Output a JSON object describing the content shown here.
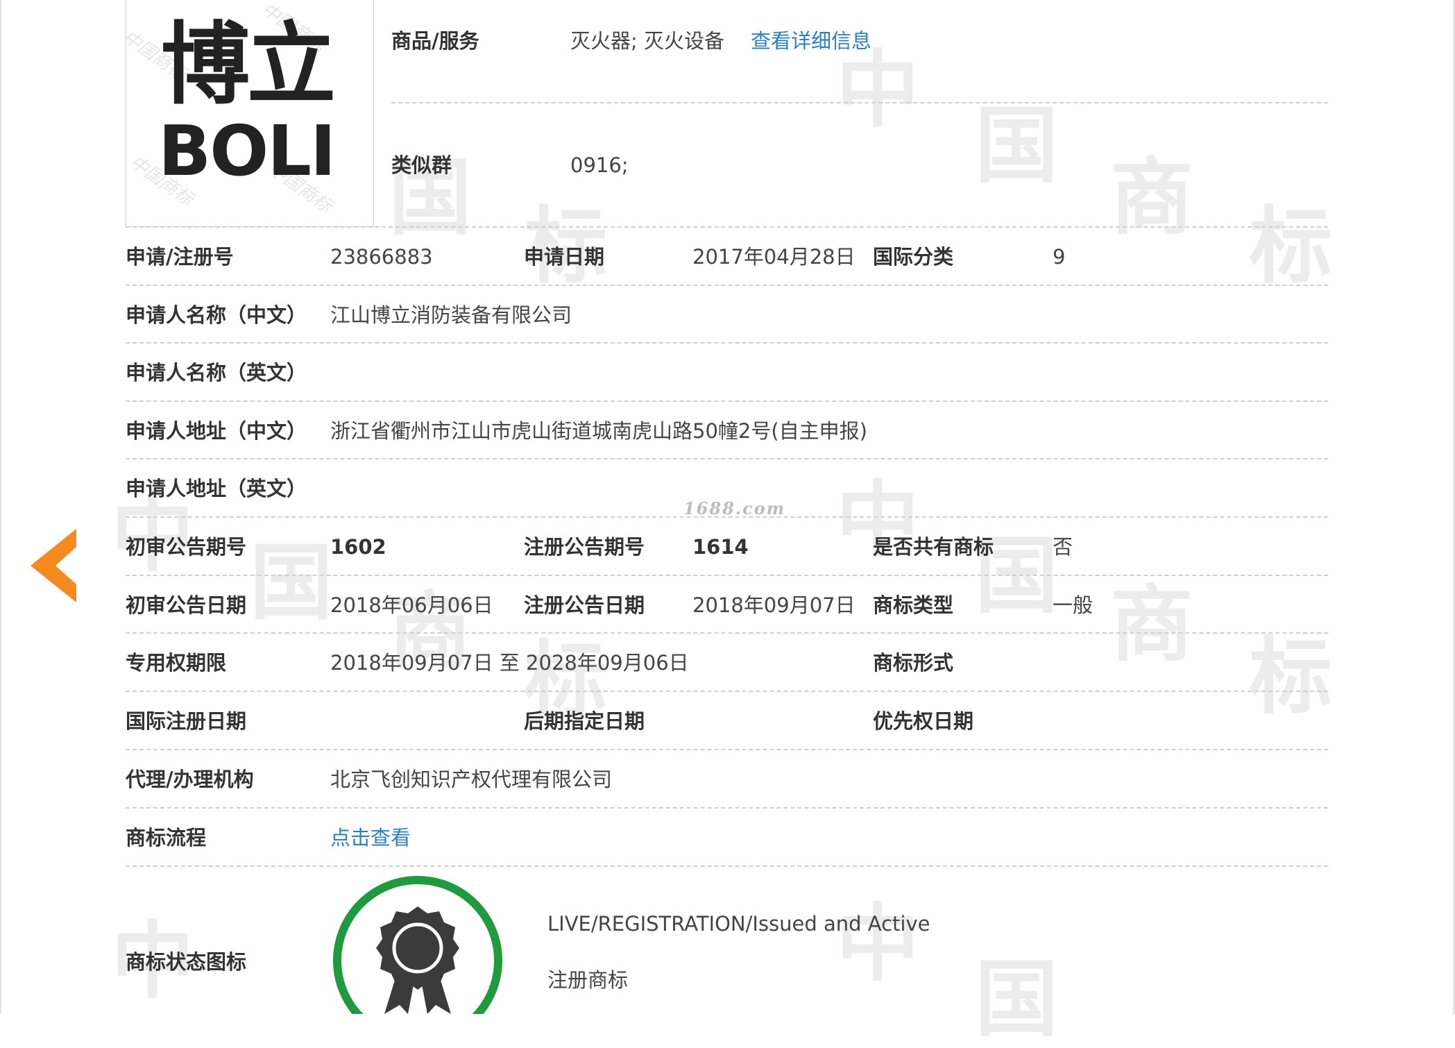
{
  "colors": {
    "accent_link": "#2a7fc2",
    "arrow": "#f58a1f",
    "badge_ring": "#1f9a3c",
    "badge_medal": "#3b3b3b"
  },
  "icons": {
    "back": "chevron-left-icon",
    "status": "award-ribbon-icon"
  },
  "watermark": {
    "site": "1688.com",
    "chars": [
      "中",
      "国",
      "商",
      "标"
    ],
    "logo_stamp": "中国商标"
  },
  "logo": {
    "cn": "博立",
    "en": "BOLI"
  },
  "goods": {
    "label": "商品/服务",
    "value": "灭火器; 灭火设备",
    "link": "查看详细信息"
  },
  "similar_group": {
    "label": "类似群",
    "value": "0916;"
  },
  "rows": {
    "reg": {
      "label_no": "申请/注册号",
      "no": "23866883",
      "label_date": "申请日期",
      "date": "2017年04月28日",
      "label_class": "国际分类",
      "class": "9"
    },
    "applicant_cn": {
      "label": "申请人名称（中文）",
      "value": "江山博立消防装备有限公司"
    },
    "applicant_en": {
      "label": "申请人名称（英文）",
      "value": ""
    },
    "address_cn": {
      "label": "申请人地址（中文）",
      "value": "浙江省衢州市江山市虎山街道城南虎山路50幢2号(自主申报)"
    },
    "address_en": {
      "label": "申请人地址（英文）",
      "value": ""
    },
    "notice_no": {
      "label_prelim": "初审公告期号",
      "prelim": "1602",
      "label_reg": "注册公告期号",
      "reg": "1614",
      "label_shared": "是否共有商标",
      "shared": "否"
    },
    "notice_date": {
      "label_prelim": "初审公告日期",
      "prelim": "2018年06月06日",
      "label_reg": "注册公告日期",
      "reg": "2018年09月07日",
      "label_type": "商标类型",
      "type": "一般"
    },
    "term": {
      "label": "专用权期限",
      "value": "2018年09月07日 至 2028年09月06日",
      "label_form": "商标形式",
      "form": ""
    },
    "intl": {
      "label_intl": "国际注册日期",
      "intl": "",
      "label_later": "后期指定日期",
      "later": "",
      "label_priority": "优先权日期",
      "priority": ""
    },
    "agent": {
      "label": "代理/办理机构",
      "value": "北京飞创知识产权代理有限公司"
    },
    "flow": {
      "label": "商标流程",
      "link": "点击查看"
    },
    "status": {
      "label": "商标状态图标",
      "en": "LIVE/REGISTRATION/Issued and Active",
      "cn": "注册商标"
    }
  }
}
